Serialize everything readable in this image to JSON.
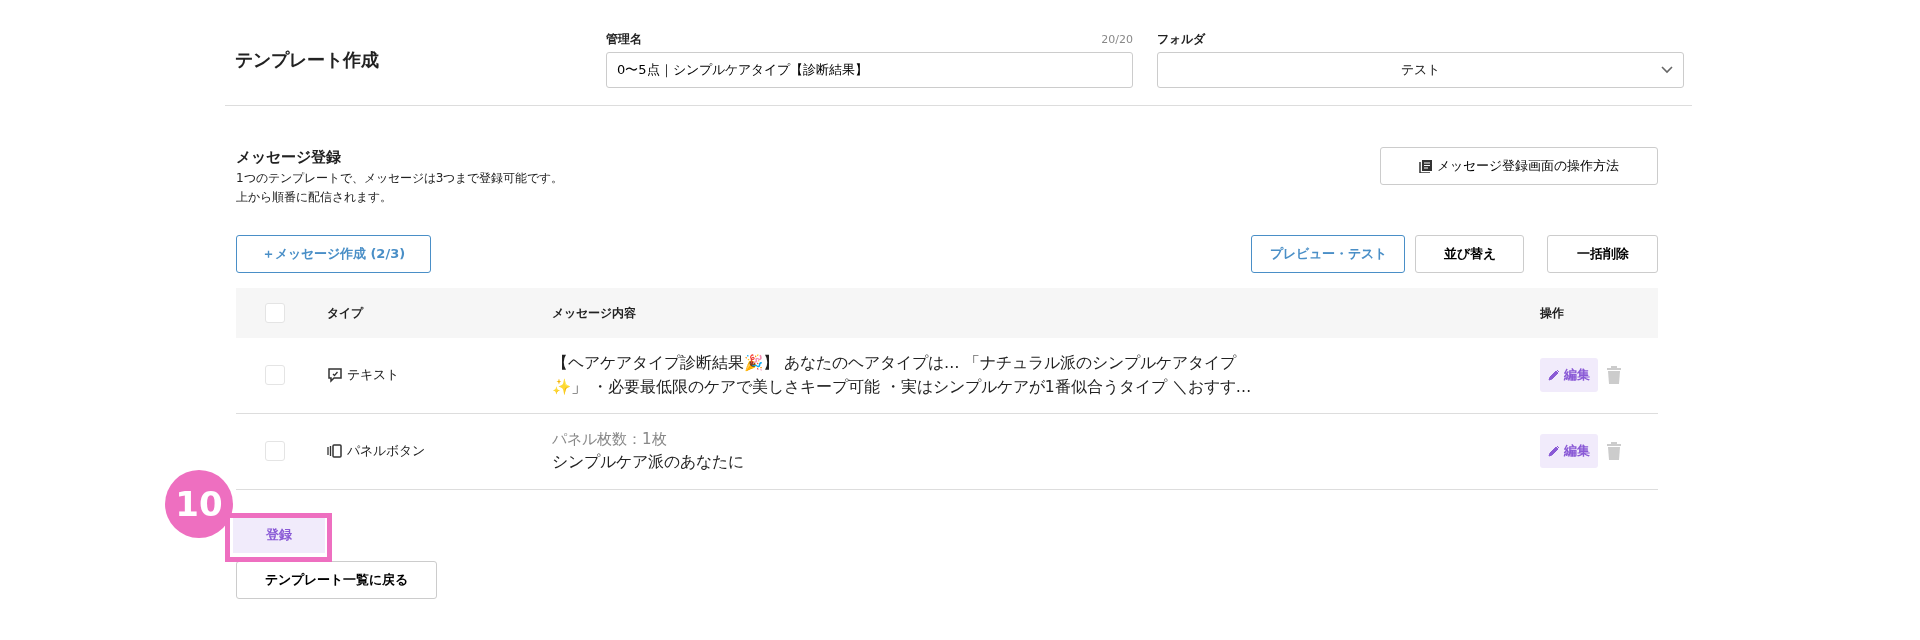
{
  "header": {
    "title": "テンプレート作成",
    "name_field": {
      "label": "管理名",
      "counter": "20/20",
      "value": "0〜5点｜シンプルケアタイプ【診断結果】"
    },
    "folder_field": {
      "label": "フォルダ",
      "value": "テスト"
    }
  },
  "messages": {
    "title": "メッセージ登録",
    "description": [
      "1つのテンプレートで、メッセージは3つまで登録可能です。",
      "上から順番に配信されます。"
    ],
    "help_button": "メッセージ登録画面の操作方法",
    "create_button": "＋メッセージ作成 (2/3)",
    "actions": [
      "プレビュー・テスト",
      "並び替え",
      "一括削除"
    ]
  },
  "table": {
    "columns": [
      "タイプ",
      "メッセージ内容",
      "操作"
    ],
    "header_checked": false,
    "rows": [
      {
        "kind": "text",
        "checked": false,
        "type": "テキスト",
        "content": [
          "【ヘアケアタイプ診断結果🎉】 あなたのヘアタイプは… 「ナチュラル派のシンプルケアタイプ",
          "✨」 ・必要最低限のケアで美しさキープ可能 ・実はシンプルケアが1番似合うタイプ ＼おすす…"
        ],
        "edit": "編集"
      },
      {
        "kind": "panel",
        "checked": false,
        "type": "パネルボタン",
        "sub": "パネル枚数：1枚",
        "content": [
          "シンプルケア派のあなたに"
        ],
        "edit": "編集"
      }
    ]
  },
  "footer": {
    "submit": "登録",
    "back": "テンプレート一覧に戻る"
  },
  "annotation": {
    "number": "10"
  }
}
